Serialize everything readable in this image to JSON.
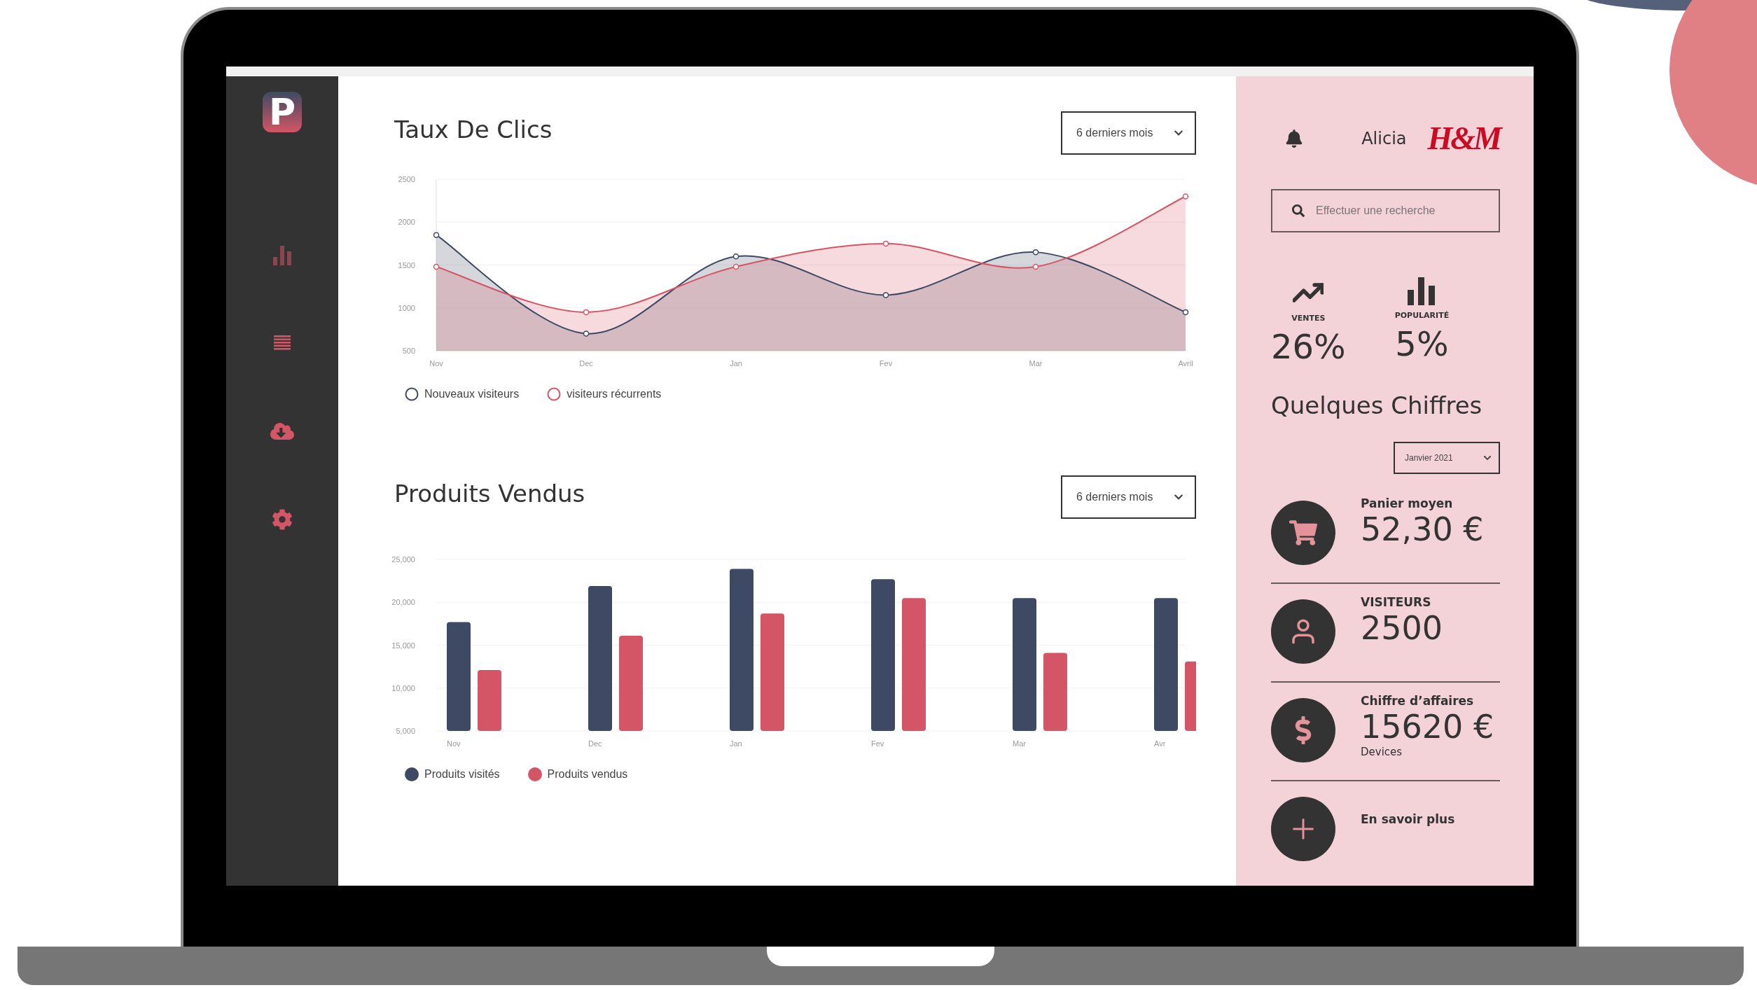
{
  "sidebar": {
    "logo": "P",
    "items": [
      {
        "kind": "chart"
      },
      {
        "kind": "list"
      },
      {
        "kind": "download"
      },
      {
        "kind": "settings"
      }
    ]
  },
  "charts": [
    {
      "title": "Taux De Clics",
      "range": "6 derniers mois",
      "chart_data": {
        "type": "area",
        "grid": true,
        "categories": [
          "Nov",
          "Dec",
          "Jan",
          "Fev",
          "Mar",
          "Avril"
        ],
        "ylim": [
          500,
          2500
        ],
        "yticks": [
          500,
          1000,
          1500,
          2000,
          2500
        ],
        "series": [
          {
            "name": "Nouveaux visiteurs",
            "color": "#3e4a63",
            "marker": "hollow-circle",
            "values": [
              1850,
              700,
              1600,
              1150,
              1650,
              950
            ]
          },
          {
            "name": "visiteurs récurrents",
            "color": "#d45565",
            "marker": "hollow-circle",
            "values": [
              1480,
              950,
              1480,
              1750,
              1480,
              2300
            ]
          }
        ]
      }
    },
    {
      "title": "Produits Vendus",
      "range": "6 derniers mois",
      "chart_data": {
        "type": "bar",
        "grid": true,
        "categories": [
          "Nov",
          "Dec",
          "Jan",
          "Fev",
          "Mar",
          "Avr"
        ],
        "ylim": [
          5000,
          25000
        ],
        "yticks": [
          {
            "value": 5000,
            "label": "5,000"
          },
          {
            "value": 10000,
            "label": "10,000"
          },
          {
            "value": 15000,
            "label": "15,000"
          },
          {
            "value": 20000,
            "label": "20,000"
          },
          {
            "value": 25000,
            "label": "25,000"
          }
        ],
        "series": [
          {
            "name": "Produits visités",
            "color": "#3e4a63",
            "values": [
              17700,
              21900,
              23900,
              22700,
              20500,
              20500
            ]
          },
          {
            "name": "Produits vendus",
            "color": "#d45565",
            "values": [
              12100,
              16100,
              18700,
              20500,
              14100,
              13100
            ]
          }
        ]
      }
    }
  ],
  "right_panel": {
    "user": "Alicia",
    "brand": "H&M",
    "search": {
      "placeholder": "Effectuer une recherche"
    },
    "stats": [
      {
        "kind": "trend",
        "label": "VENTES",
        "value": "26%"
      },
      {
        "kind": "bars",
        "label": "POPULARITÉ",
        "value": "5%"
      }
    ],
    "section_title": "Quelques Chiffres",
    "period": "Janvier 2021",
    "kpis": [
      {
        "kind": "cart",
        "label": "Panier moyen",
        "value": "52,30 €"
      },
      {
        "kind": "user",
        "label": "VISITEURS",
        "value": "2500"
      },
      {
        "kind": "dollar",
        "label": "Chiffre d’affaires",
        "value": "15620 €",
        "note": "Devices"
      },
      {
        "kind": "plus",
        "label": "En savoir plus"
      }
    ]
  }
}
